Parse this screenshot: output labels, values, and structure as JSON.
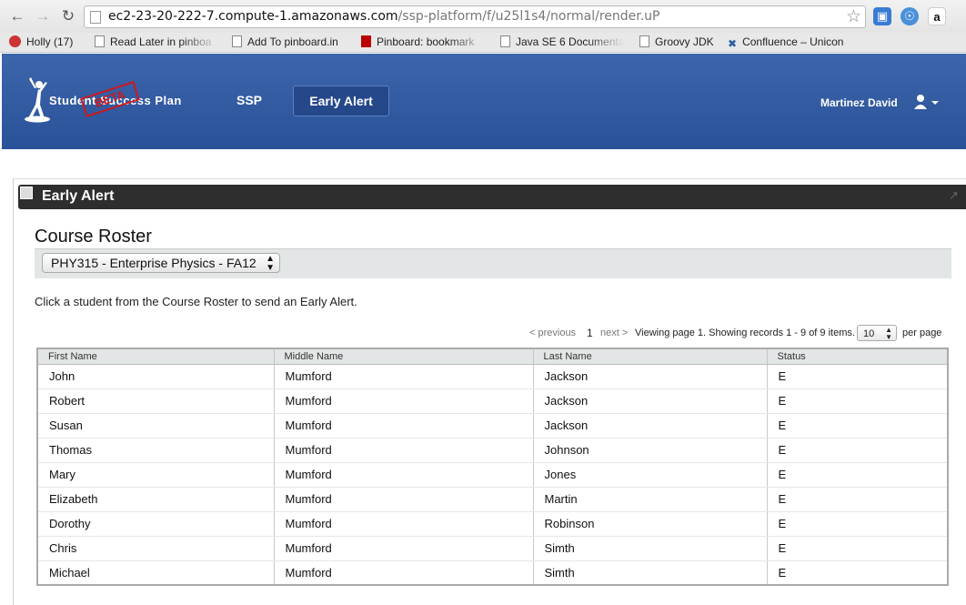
{
  "browser": {
    "url_host": "ec2-23-20-222-7.compute-1.amazonaws.com",
    "url_path": "/ssp-platform/f/u25l1s4/normal/render.uP",
    "bookmarks": [
      {
        "label": "Holly (17)",
        "icon": "holly-icon"
      },
      {
        "label": "Read Later in pinboa",
        "icon": "page-icon"
      },
      {
        "label": "Add To pinboard.in",
        "icon": "page-icon"
      },
      {
        "label": "Pinboard: bookmark",
        "icon": "pinboard-icon"
      },
      {
        "label": "Java SE 6 Documenta",
        "icon": "page-icon"
      },
      {
        "label": "Groovy JDK",
        "icon": "page-icon"
      },
      {
        "label": "Confluence – Unicon",
        "icon": "confluence-icon"
      }
    ]
  },
  "header": {
    "logo_text": "Student Success Plan",
    "beta_stamp": "BETA",
    "nav": [
      {
        "label": "SSP"
      },
      {
        "label": "Early Alert"
      }
    ],
    "user_name": "Martinez David"
  },
  "portlet": {
    "title": "Early Alert",
    "heading": "Course Roster",
    "course": "PHY315 - Enterprise Physics - FA12",
    "instruction": "Click a student from the Course Roster to send an Early Alert."
  },
  "pager": {
    "previous": "< previous",
    "page": "1",
    "next": "next >",
    "info": "Viewing page 1. Showing records 1 - 9 of 9 items.",
    "page_size": "10",
    "per_page": "per page"
  },
  "table": {
    "columns": [
      "First Name",
      "Middle Name",
      "Last Name",
      "Status"
    ],
    "rows": [
      [
        "John",
        "Mumford",
        "Jackson",
        "E"
      ],
      [
        "Robert",
        "Mumford",
        "Jackson",
        "E"
      ],
      [
        "Susan",
        "Mumford",
        "Jackson",
        "E"
      ],
      [
        "Thomas",
        "Mumford",
        "Johnson",
        "E"
      ],
      [
        "Mary",
        "Mumford",
        "Jones",
        "E"
      ],
      [
        "Elizabeth",
        "Mumford",
        "Martin",
        "E"
      ],
      [
        "Dorothy",
        "Mumford",
        "Robinson",
        "E"
      ],
      [
        "Chris",
        "Mumford",
        "Simth",
        "E"
      ],
      [
        "Michael",
        "Mumford",
        "Simth",
        "E"
      ]
    ]
  },
  "colors": {
    "header_blue": "#2a5298",
    "portlet_bar": "#2e2e2e",
    "beta_red": "#d11"
  }
}
